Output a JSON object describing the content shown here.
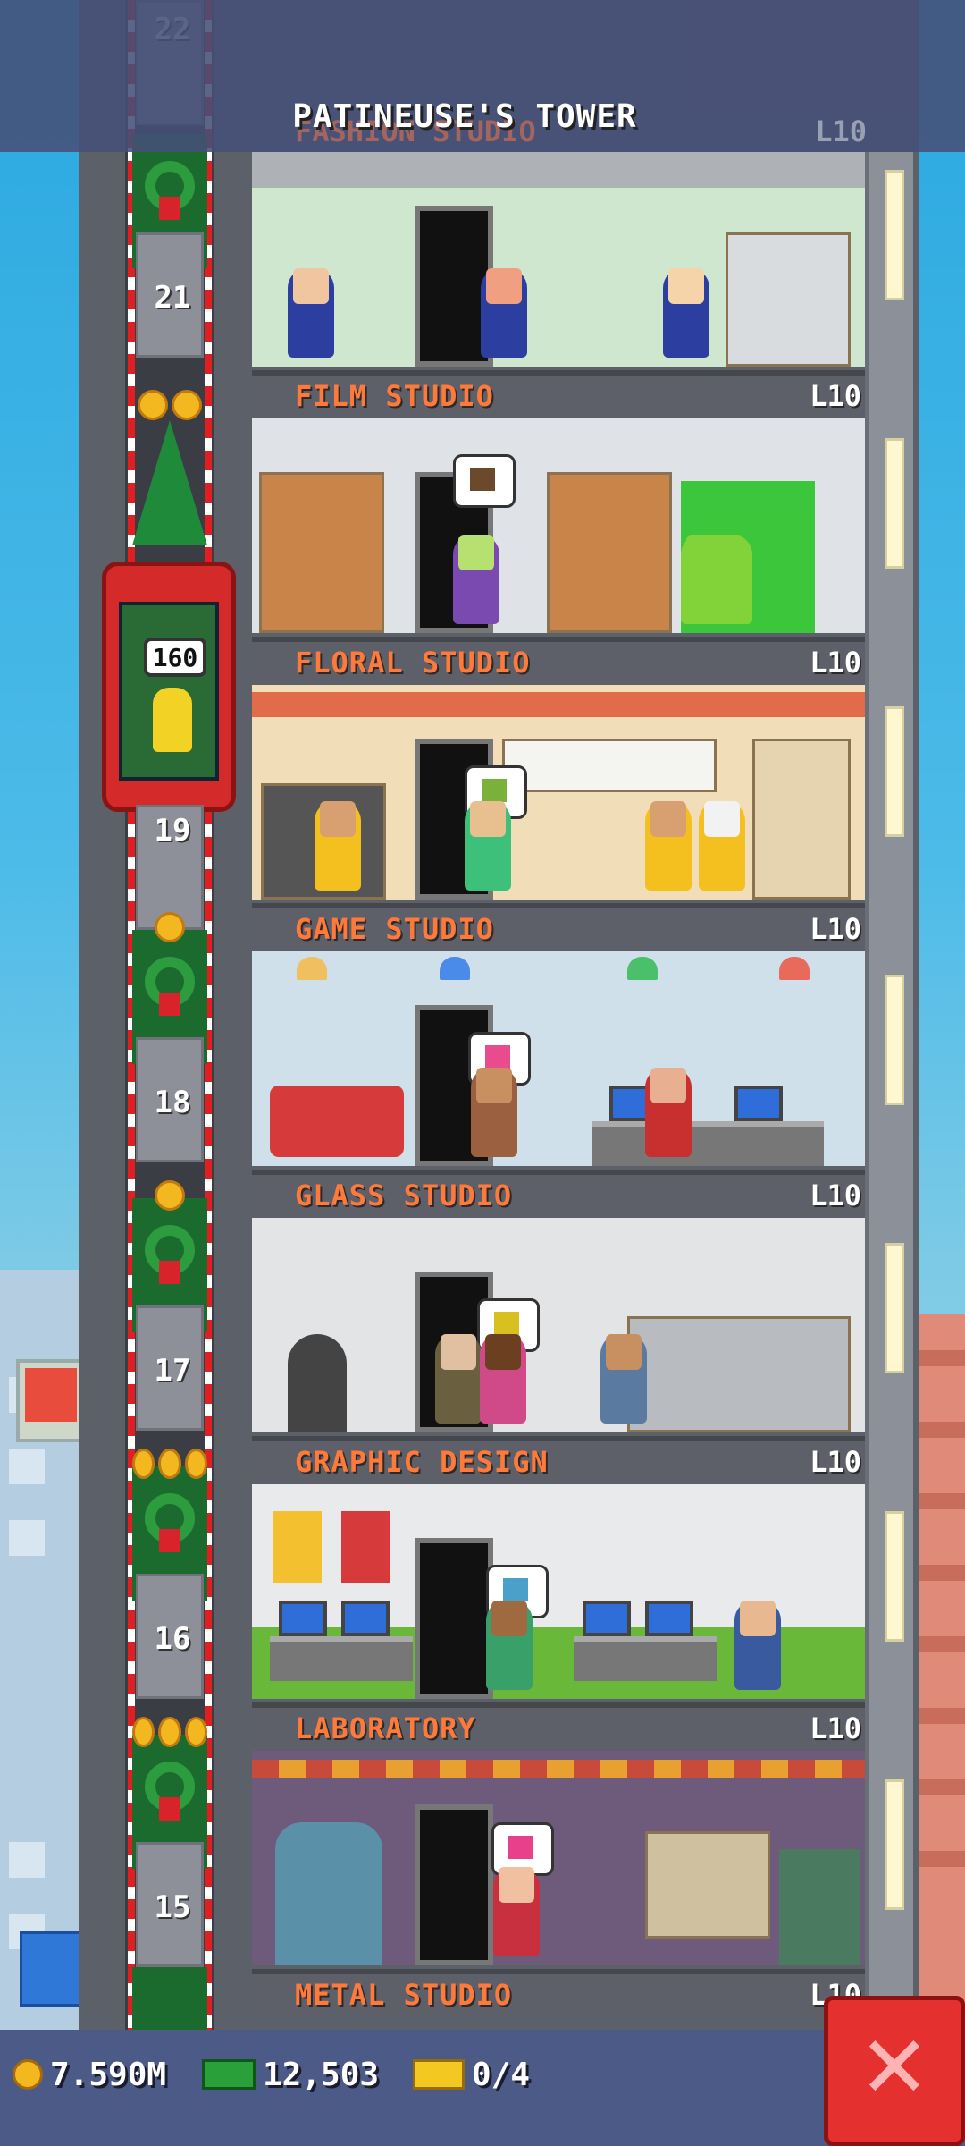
{
  "header": {
    "tower_title": "PATINEUSE'S TOWER",
    "top_floor_partial_name": "FASHION STUDIO",
    "top_floor_partial_level": "L10"
  },
  "elevator": {
    "car_badge": "160",
    "floor_numbers": [
      "22",
      "21",
      "19",
      "18",
      "17",
      "16",
      "15"
    ]
  },
  "floors": [
    {
      "name": "FILM STUDIO",
      "level": "L10"
    },
    {
      "name": "FLORAL STUDIO",
      "level": "L10"
    },
    {
      "name": "GAME STUDIO",
      "level": "L10"
    },
    {
      "name": "GLASS STUDIO",
      "level": "L10"
    },
    {
      "name": "GRAPHIC DESIGN",
      "level": "L10"
    },
    {
      "name": "LABORATORY",
      "level": "L10"
    },
    {
      "name": "METAL STUDIO",
      "level": "L10"
    }
  ],
  "resources": {
    "coins": "7.590M",
    "bux": "12,503",
    "tickets": "0/4"
  },
  "icons": {
    "coins": "coin-icon",
    "bux": "bux-icon",
    "tickets": "golden-ticket-icon",
    "close": "close-icon"
  },
  "colors": {
    "floor_label": "#ff7a3a",
    "close_button": "#e53030",
    "bottom_bar": "#4b5a86"
  }
}
